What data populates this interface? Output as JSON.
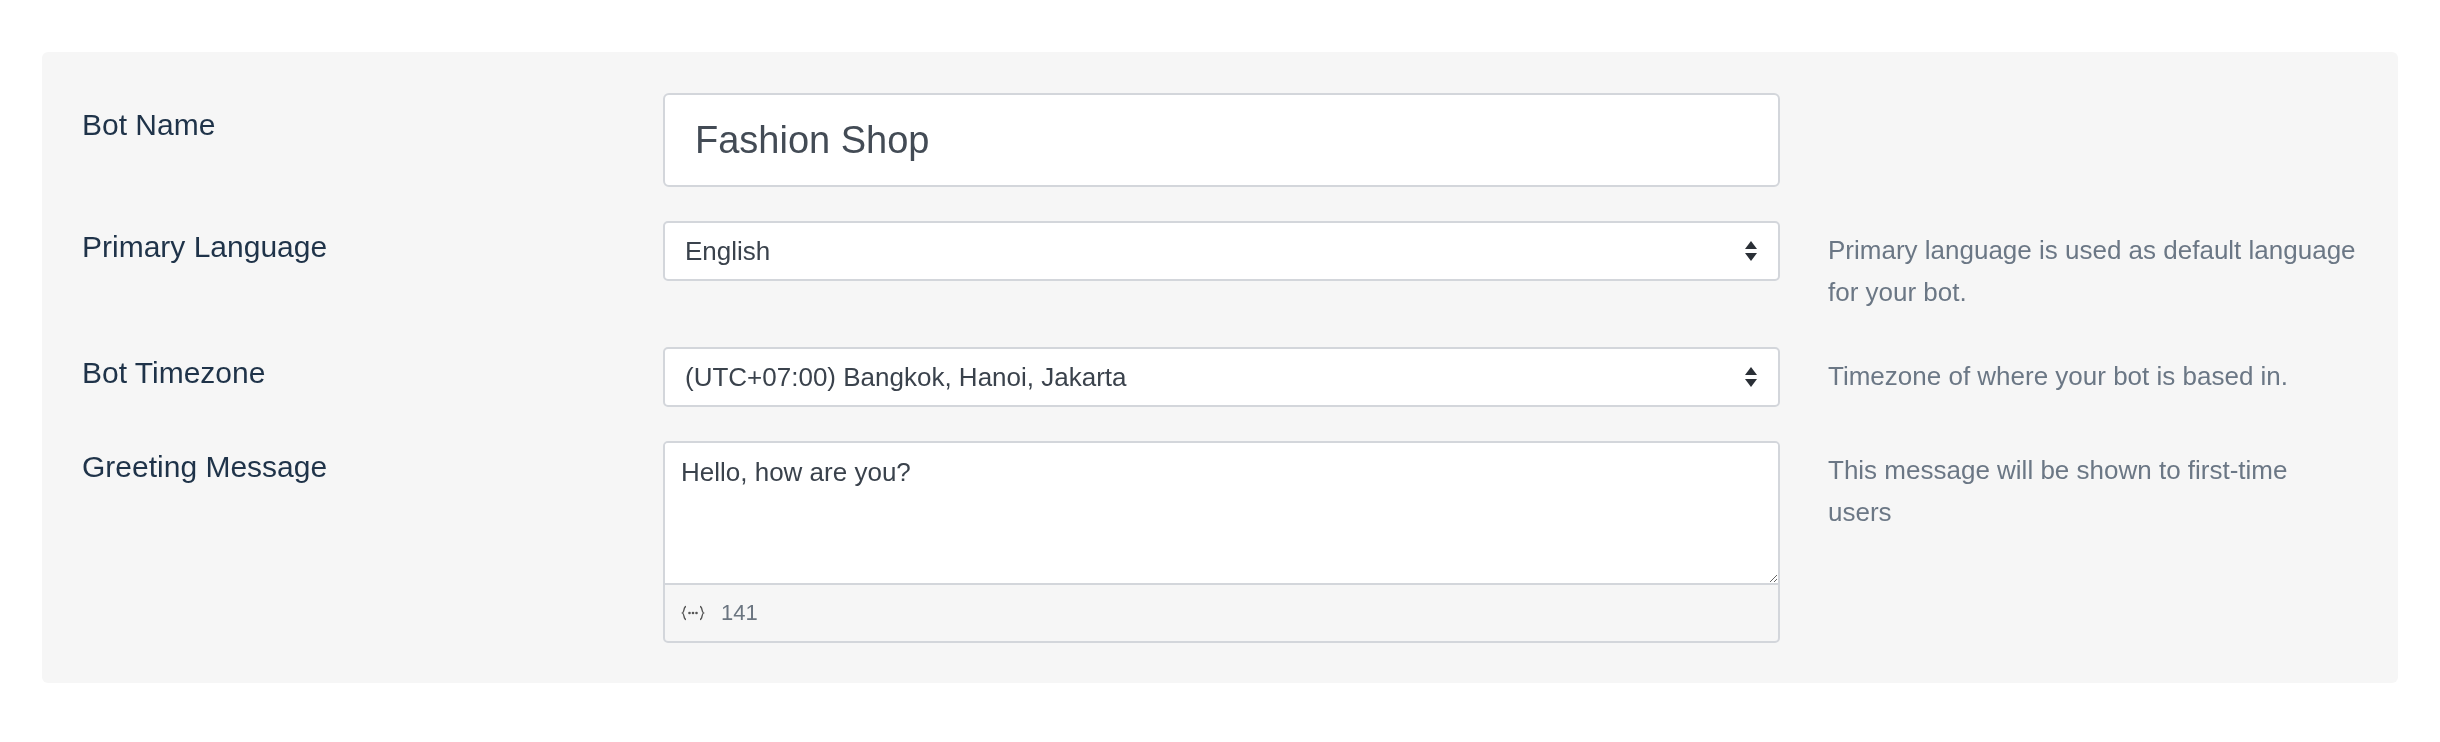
{
  "fields": [
    {
      "kind": "text",
      "label": "Bot Name",
      "value": "Fashion Shop"
    },
    {
      "kind": "select",
      "label": "Primary Language",
      "value": "English",
      "help": "Primary language is used as default language for your bot."
    },
    {
      "kind": "select",
      "label": "Bot Timezone",
      "value": "(UTC+07:00) Bangkok, Hanoi, Jakarta",
      "help": "Timezone of where your bot is based in."
    },
    {
      "kind": "textarea",
      "label": "Greeting Message",
      "value": "Hello, how are you?",
      "counter": "141",
      "help": "This message will be shown to first-time users"
    }
  ]
}
